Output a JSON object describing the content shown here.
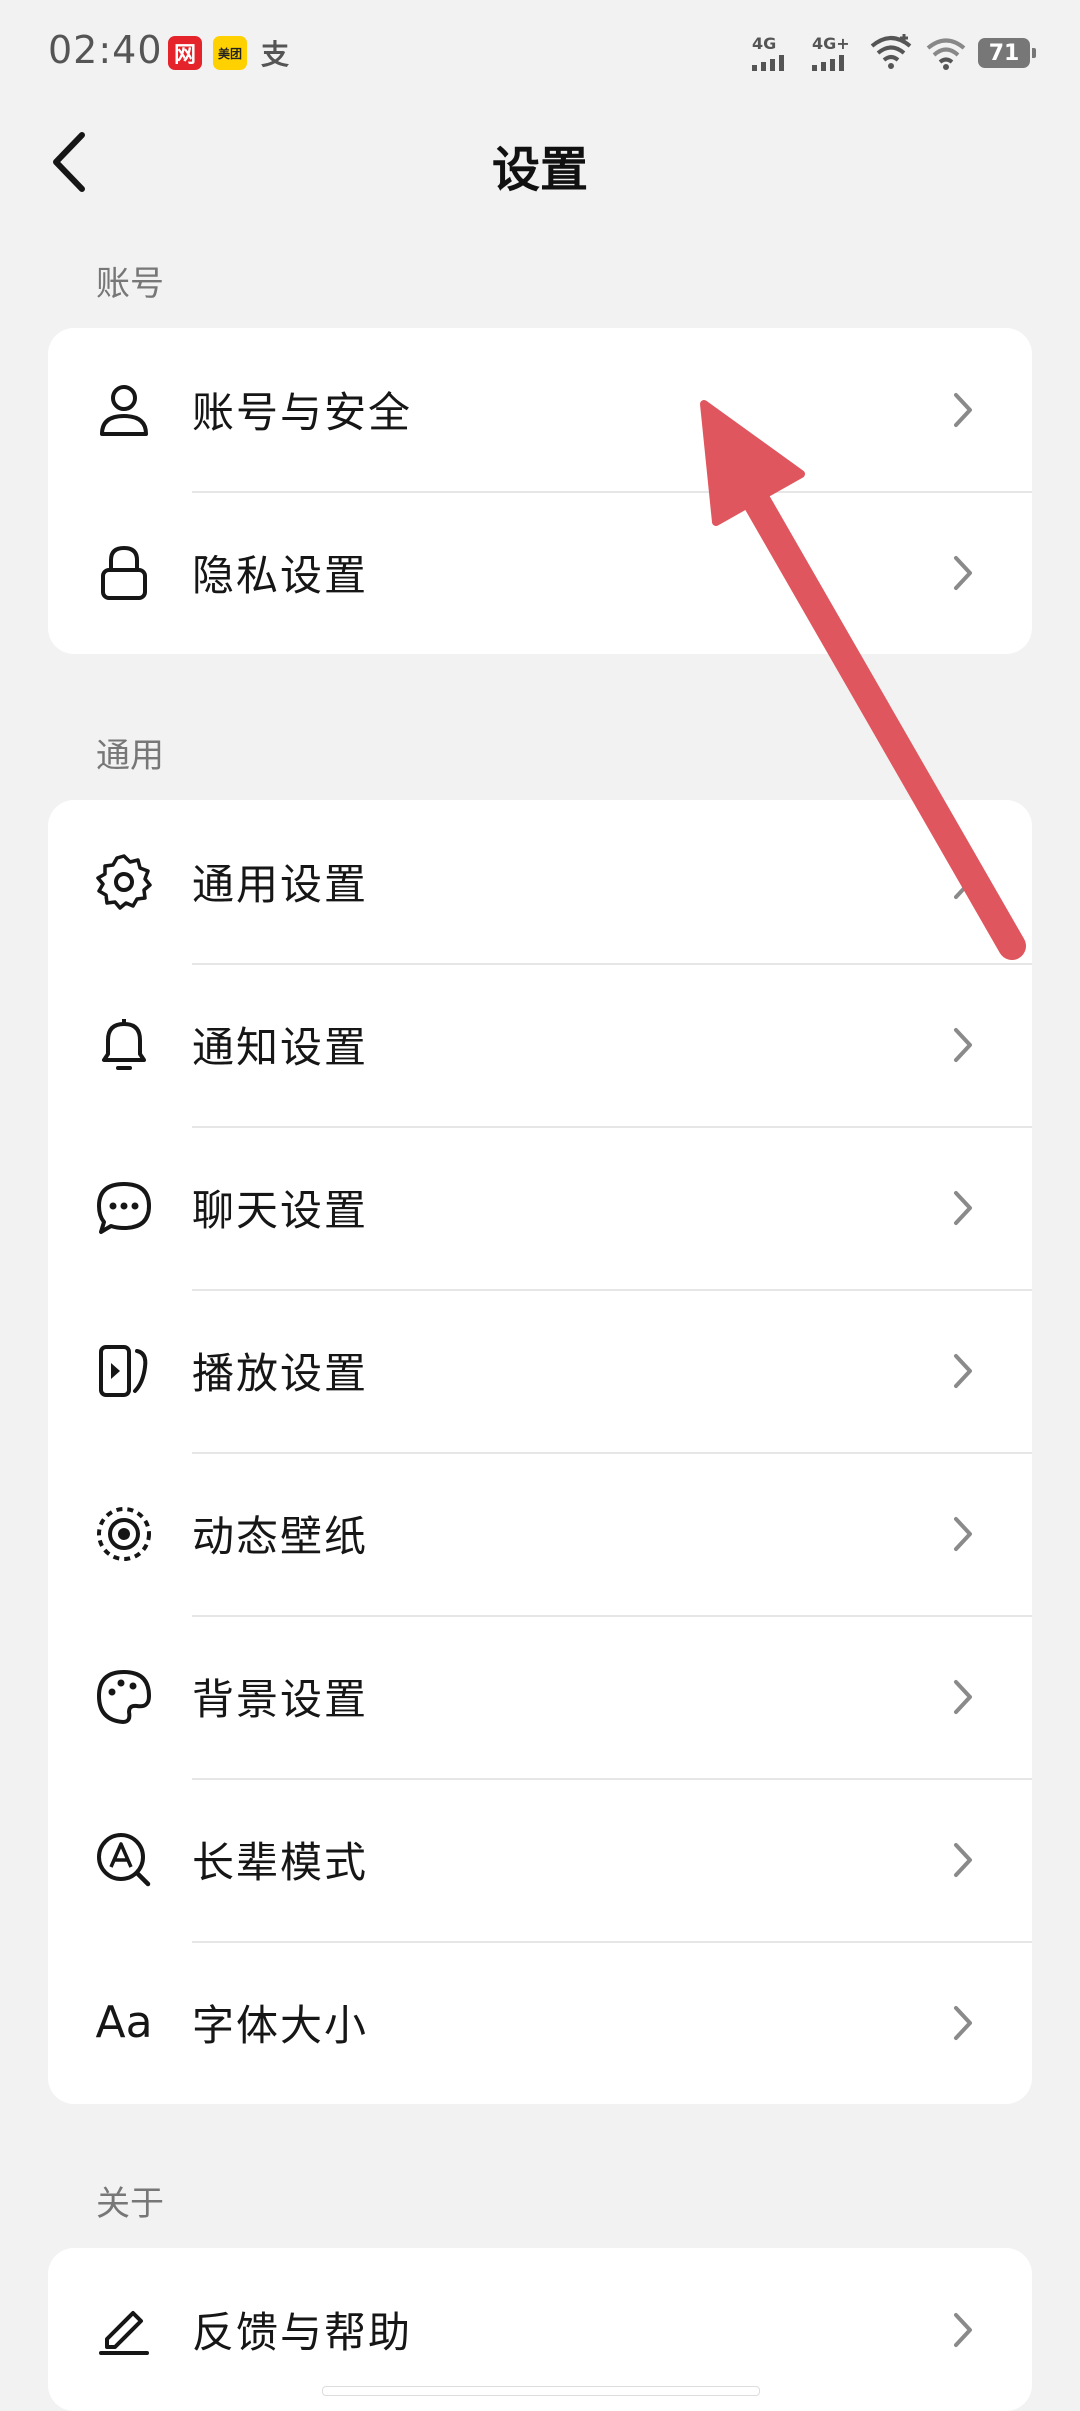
{
  "status_bar": {
    "time": "02:40",
    "app_badges": [
      "网",
      "美团",
      "支"
    ],
    "signal_1": "4G",
    "signal_2": "4G+",
    "battery": "71"
  },
  "header": {
    "title": "设置"
  },
  "sections": [
    {
      "label": "账号",
      "items": [
        {
          "label": "账号与安全",
          "icon": "person-icon"
        },
        {
          "label": "隐私设置",
          "icon": "lock-icon"
        }
      ]
    },
    {
      "label": "通用",
      "items": [
        {
          "label": "通用设置",
          "icon": "gear-icon"
        },
        {
          "label": "通知设置",
          "icon": "bell-icon"
        },
        {
          "label": "聊天设置",
          "icon": "chat-bubble-icon"
        },
        {
          "label": "播放设置",
          "icon": "play-screen-icon"
        },
        {
          "label": "动态壁纸",
          "icon": "live-wallpaper-icon"
        },
        {
          "label": "背景设置",
          "icon": "palette-icon"
        },
        {
          "label": "长辈模式",
          "icon": "elder-mode-icon"
        },
        {
          "label": "字体大小",
          "icon": "font-size-icon",
          "glyph": "Aa"
        }
      ]
    },
    {
      "label": "关于",
      "items": [
        {
          "label": "反馈与帮助",
          "icon": "pencil-icon"
        }
      ]
    }
  ],
  "colors": {
    "background": "#f2f2f2",
    "card": "#ffffff",
    "annotation_arrow": "#e0565e"
  }
}
